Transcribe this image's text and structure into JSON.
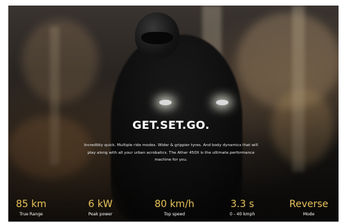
{
  "hero": {
    "headline": "GET.SET.GO.",
    "description": "Incredibly quick. Multiple ride modes. Wider & grippier tyres. And body dynamics that will play along with all your urban acrobatics. The Ather 450X is the ultimate performance machine for you."
  },
  "stats": [
    {
      "value": "85 km",
      "label": "True Range"
    },
    {
      "value": "6 kW",
      "label": "Peak power"
    },
    {
      "value": "80 km/h",
      "label": "Top speed"
    },
    {
      "value": "3.3 s",
      "label": "0 - 40 kmph"
    },
    {
      "value": "Reverse",
      "label": "Mode"
    }
  ],
  "colors": {
    "accent": "#e8c35a",
    "text": "#ffffff",
    "background": "#1c1917"
  }
}
